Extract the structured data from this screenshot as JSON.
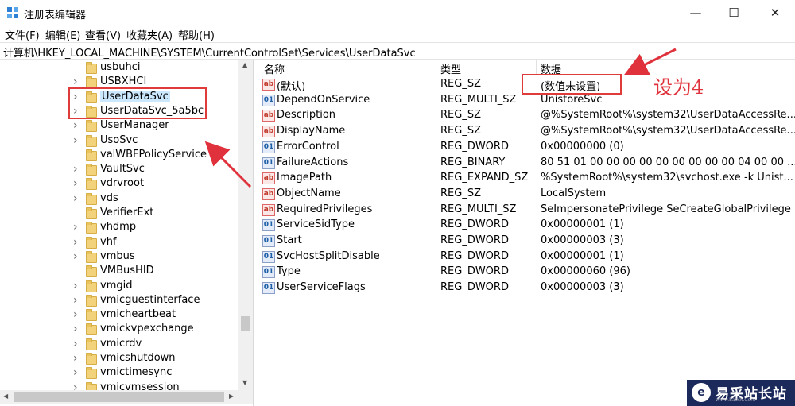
{
  "window": {
    "title": "注册表编辑器",
    "minimize_label": "—",
    "maximize_label": "☐",
    "close_label": "✕"
  },
  "menu": [
    "文件(F)",
    "编辑(E)",
    "查看(V)",
    "收藏夹(A)",
    "帮助(H)"
  ],
  "address": "计算机\\HKEY_LOCAL_MACHINE\\SYSTEM\\CurrentControlSet\\Services\\UserDataSvc",
  "tree": {
    "items": [
      {
        "label": "usbuhci",
        "expandable": false
      },
      {
        "label": "USBXHCI",
        "expandable": true
      },
      {
        "label": "UserDataSvc",
        "expandable": true,
        "selected": true
      },
      {
        "label": "UserDataSvc_5a5bc",
        "expandable": true
      },
      {
        "label": "UserManager",
        "expandable": true
      },
      {
        "label": "UsoSvc",
        "expandable": true
      },
      {
        "label": "valWBFPolicyService",
        "expandable": false
      },
      {
        "label": "VaultSvc",
        "expandable": true
      },
      {
        "label": "vdrvroot",
        "expandable": true
      },
      {
        "label": "vds",
        "expandable": true
      },
      {
        "label": "VerifierExt",
        "expandable": false
      },
      {
        "label": "vhdmp",
        "expandable": true
      },
      {
        "label": "vhf",
        "expandable": true
      },
      {
        "label": "vmbus",
        "expandable": true
      },
      {
        "label": "VMBusHID",
        "expandable": false
      },
      {
        "label": "vmgid",
        "expandable": true
      },
      {
        "label": "vmicguestinterface",
        "expandable": true
      },
      {
        "label": "vmicheartbeat",
        "expandable": true
      },
      {
        "label": "vmickvpexchange",
        "expandable": true
      },
      {
        "label": "vmicrdv",
        "expandable": true
      },
      {
        "label": "vmicshutdown",
        "expandable": true
      },
      {
        "label": "vmictimesync",
        "expandable": true
      },
      {
        "label": "vmicvmsession",
        "expandable": true
      }
    ]
  },
  "columns": {
    "name": "名称",
    "type": "类型",
    "data": "数据"
  },
  "values": [
    {
      "icon": "ab",
      "name": "(默认)",
      "type": "REG_SZ",
      "data": "(数值未设置)"
    },
    {
      "icon": "bin",
      "name": "DependOnService",
      "type": "REG_MULTI_SZ",
      "data": "UnistoreSvc"
    },
    {
      "icon": "ab",
      "name": "Description",
      "type": "REG_SZ",
      "data": "@%SystemRoot%\\system32\\UserDataAccessRe..."
    },
    {
      "icon": "ab",
      "name": "DisplayName",
      "type": "REG_SZ",
      "data": "@%SystemRoot%\\system32\\UserDataAccessRe..."
    },
    {
      "icon": "bin",
      "name": "ErrorControl",
      "type": "REG_DWORD",
      "data": "0x00000000 (0)"
    },
    {
      "icon": "bin",
      "name": "FailureActions",
      "type": "REG_BINARY",
      "data": "80 51 01 00 00 00 00 00 00 00 00 00 04 00 00 ..."
    },
    {
      "icon": "ab",
      "name": "ImagePath",
      "type": "REG_EXPAND_SZ",
      "data": "%SystemRoot%\\system32\\svchost.exe -k Unist..."
    },
    {
      "icon": "ab",
      "name": "ObjectName",
      "type": "REG_SZ",
      "data": "LocalSystem"
    },
    {
      "icon": "ab",
      "name": "RequiredPrivileges",
      "type": "REG_MULTI_SZ",
      "data": "SeImpersonatePrivilege SeCreateGlobalPrivilege"
    },
    {
      "icon": "bin",
      "name": "ServiceSidType",
      "type": "REG_DWORD",
      "data": "0x00000001 (1)"
    },
    {
      "icon": "bin",
      "name": "Start",
      "type": "REG_DWORD",
      "data": "0x00000003 (3)"
    },
    {
      "icon": "bin",
      "name": "SvcHostSplitDisable",
      "type": "REG_DWORD",
      "data": "0x00000001 (1)"
    },
    {
      "icon": "bin",
      "name": "Type",
      "type": "REG_DWORD",
      "data": "0x00000060 (96)"
    },
    {
      "icon": "bin",
      "name": "UserServiceFlags",
      "type": "REG_DWORD",
      "data": "0x00000003 (3)"
    }
  ],
  "annotation": {
    "text": "设为4",
    "color": "#e0323c"
  },
  "watermark": {
    "text": "易采站长站",
    "sub": "Www.Easck.Com",
    "logo": "e"
  },
  "colors": {
    "selection": "#cce8ff",
    "folder": "#f2d27a",
    "annotation_red": "#e03b3b"
  }
}
